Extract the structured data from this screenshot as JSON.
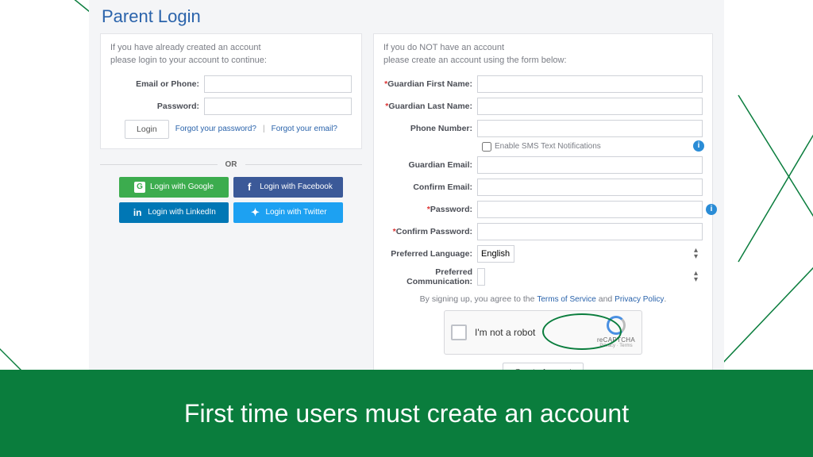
{
  "title": "Parent Login",
  "login_intro_l1": "If you have already created an account",
  "login_intro_l2": "please login to your account to continue:",
  "login": {
    "email_label": "Email or Phone:",
    "password_label": "Password:",
    "login_btn": "Login",
    "forgot_pw": "Forgot your password?",
    "sep": "|",
    "forgot_email": "Forgot your email?"
  },
  "or_label": "OR",
  "social": {
    "google": "Login with Google",
    "facebook": "Login with Facebook",
    "linkedin": "Login with LinkedIn",
    "twitter": "Login with Twitter"
  },
  "register_intro_l1": "If you do NOT have an account",
  "register_intro_l2": "please create an account using the form below:",
  "reg": {
    "first_name": "Guardian First Name:",
    "last_name": "Guardian Last Name:",
    "phone": "Phone Number:",
    "sms": "Enable SMS Text Notifications",
    "email": "Guardian Email:",
    "confirm_email": "Confirm Email:",
    "password": "Password:",
    "confirm_password": "Confirm Password:",
    "language": "Preferred Language:",
    "language_value": "English",
    "communication": "Preferred Communication:",
    "agree_prefix": "By signing up, you agree to the ",
    "tos": "Terms of Service",
    "and": " and ",
    "privacy": "Privacy Policy",
    "period": ".",
    "captcha": "I'm not a robot",
    "captcha_brand": "reCAPTCHA",
    "captcha_sub": "Privacy · Terms",
    "create_btn": "Create Account"
  },
  "footer": "First time users must create an account"
}
